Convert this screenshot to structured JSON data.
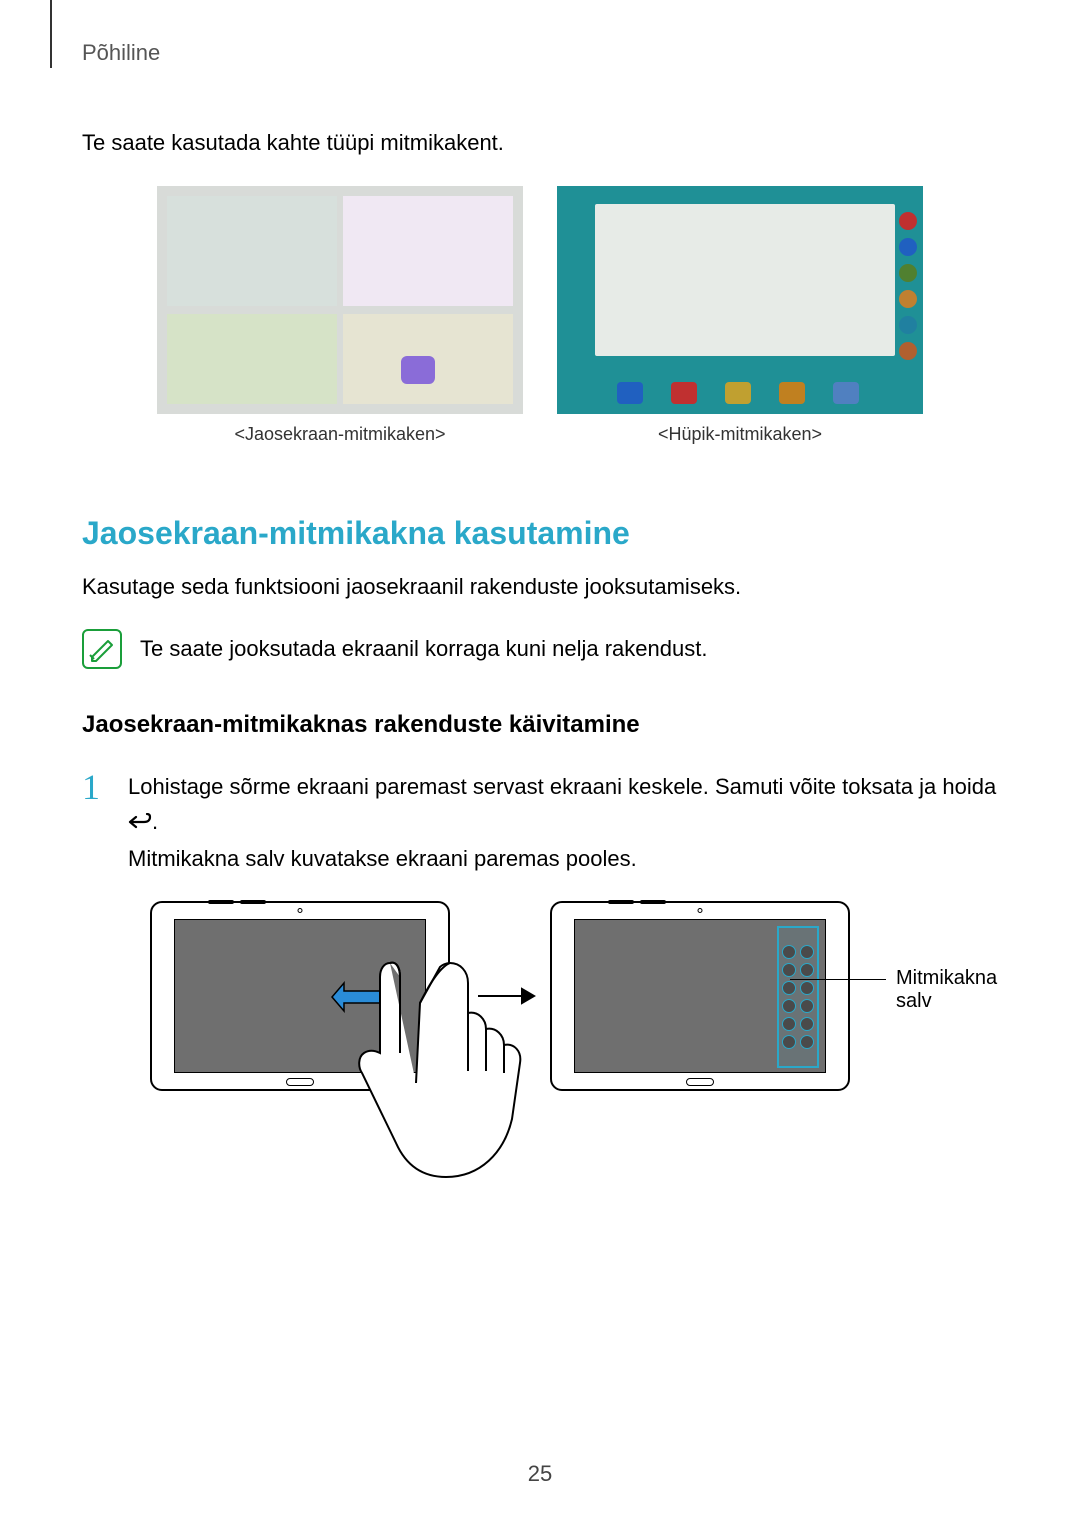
{
  "header": "Põhiline",
  "intro": "Te saate kasutada kahte tüüpi mitmikakent.",
  "captions": {
    "left": "<Jaosekraan-mitmikaken>",
    "right": "<Hüpik-mitmikaken>"
  },
  "h2": "Jaosekraan-mitmikakna kasutamine",
  "p1": "Kasutage seda funktsiooni jaosekraanil rakenduste jooksutamiseks.",
  "note": "Te saate jooksutada ekraanil korraga kuni nelja rakendust.",
  "h3": "Jaosekraan-mitmikaknas rakenduste käivitamine",
  "step1": {
    "num": "1",
    "text_a": "Lohistage sõrme ekraani paremast servast ekraani keskele. Samuti võite toksata ja hoida ",
    "text_b": ".",
    "text_c": "Mitmikakna salv kuvatakse ekraani paremas pooles."
  },
  "callout": "Mitmikakna salv",
  "page_number": "25"
}
